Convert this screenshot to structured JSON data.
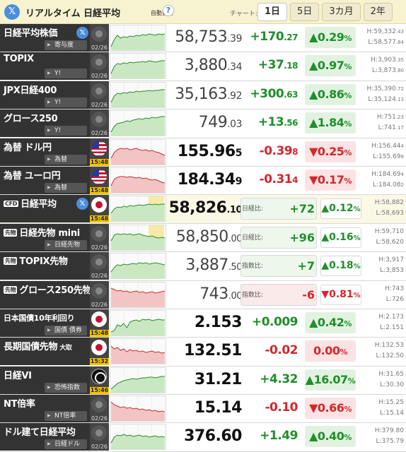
{
  "header": {
    "x_icon": "x-logo-icon",
    "title": "リアルタイム 日経平均",
    "auto_update": "自動更新",
    "help": "?",
    "chart_label": "チャート:",
    "tabs": [
      {
        "label": "1日",
        "active": true
      },
      {
        "label": "5日",
        "active": false
      },
      {
        "label": "3カ月",
        "active": false
      },
      {
        "label": "2年",
        "active": false
      }
    ]
  },
  "colors": {
    "up": "#1f8f2a",
    "down": "#d6262b",
    "up_bg": "#e2f2e0",
    "down_bg": "#fbe3e3",
    "label_bg": "#333333",
    "accent_yellow": "#f2c200"
  },
  "rows": [
    {
      "name": "日経平均株価",
      "sub": "寄与度",
      "x": true,
      "flag": "jp",
      "time": "02/26",
      "live": false,
      "price_int": "58,753",
      "price_dec": ".39",
      "chg_int": "+170",
      "chg_dec": ".27",
      "dir": "up",
      "pct": "0.29",
      "high": "59,332",
      "high_dec": ".43",
      "low": "58,577",
      "low_dec": ".84",
      "spark": [
        30,
        20,
        14,
        18,
        16,
        17,
        15,
        16,
        14,
        15,
        13,
        14,
        12,
        13,
        14,
        12,
        13,
        12
      ]
    },
    {
      "name": "TOPIX",
      "sub": "Y!",
      "flag": "jp",
      "time": "02/26",
      "live": false,
      "price_int": "3,880",
      "price_dec": ".34",
      "chg_int": "+37",
      "chg_dec": ".18",
      "dir": "up",
      "pct": "0.97",
      "high": "3,903",
      "high_dec": ".35",
      "low": "3,873",
      "low_dec": ".80",
      "spark": [
        28,
        18,
        14,
        15,
        13,
        14,
        12,
        13,
        12,
        12,
        11,
        12,
        10,
        11,
        12,
        11,
        10,
        10
      ]
    },
    {
      "name": "JPX日経400",
      "sub": "Y!",
      "flag": "jp",
      "time": "02/26",
      "live": false,
      "price_int": "35,163",
      "price_dec": ".92",
      "chg_int": "+300",
      "chg_dec": ".63",
      "dir": "up",
      "pct": "0.86",
      "high": "35,390",
      "high_dec": ".72",
      "low": "35,124",
      "low_dec": ".13",
      "spark": [
        28,
        19,
        15,
        16,
        14,
        15,
        13,
        14,
        12,
        13,
        12,
        12,
        11,
        12,
        11,
        11,
        10,
        10
      ]
    },
    {
      "name": "グロース250",
      "sub": "Y!",
      "flag": "jp",
      "time": "02/26",
      "live": false,
      "price_int": "749",
      "price_dec": ".03",
      "chg_int": "+13",
      "chg_dec": ".56",
      "dir": "up",
      "pct": "1.84",
      "high": "751",
      "high_dec": ".23",
      "low": "741",
      "low_dec": ".17",
      "spark": [
        30,
        22,
        18,
        17,
        16,
        14,
        15,
        13,
        12,
        11,
        12,
        10,
        11,
        9,
        10,
        9,
        8,
        8
      ]
    },
    {
      "name": "為替 ドル円",
      "sub": "為替",
      "flag": "us",
      "time": "15:48",
      "live": true,
      "price_int": "155.96",
      "price_dec": "5",
      "chg_int": "-0.39",
      "chg_dec": "8",
      "dir": "down",
      "pct": "0.25",
      "high": "156.44",
      "high_dec": "4",
      "low": "155.69",
      "low_dec": "8",
      "strong": true,
      "spark": [
        26,
        18,
        14,
        12,
        13,
        12,
        14,
        13,
        12,
        14,
        15,
        14,
        16,
        15,
        17,
        18,
        20,
        22
      ]
    },
    {
      "name": "為替 ユーロ円",
      "sub": "為替",
      "flag": "us",
      "time": "15:48",
      "live": true,
      "price_int": "184.34",
      "price_dec": "9",
      "chg_int": "-0.31",
      "chg_dec": "4",
      "dir": "down",
      "pct": "0.17",
      "high": "184.69",
      "high_dec": "4",
      "low": "184.08",
      "low_dec": "2",
      "strong": true,
      "spark": [
        25,
        16,
        13,
        12,
        12,
        13,
        12,
        13,
        14,
        13,
        15,
        14,
        16,
        17,
        16,
        18,
        20,
        21
      ]
    }
  ],
  "futures": [
    {
      "name": "日経平均",
      "prefix": "CFD",
      "x": true,
      "flag": "jp",
      "time": "15:48",
      "live": true,
      "cfd": true,
      "price_int": "58,826",
      "price_dec": ".10",
      "tag": "日経比:",
      "chg": "+72",
      "dir": "up",
      "pct": "0.12",
      "high": "58,882",
      "low": "58,693",
      "spark": [
        24,
        18,
        15,
        16,
        14,
        15,
        13,
        14,
        13,
        12,
        13,
        12,
        11,
        12,
        11,
        12,
        11,
        11
      ]
    },
    {
      "name": "日経先物 mini",
      "prefix": "先物",
      "sub": "日経先物",
      "flag": "jp",
      "time": "02/26",
      "live": false,
      "price_int": "58,850",
      "price_dec": ".00",
      "tag": "日経比:",
      "chg": "+96",
      "dir": "up",
      "pct": "0.16",
      "high": "59,710",
      "low": "58,620",
      "spark": [
        22,
        14,
        12,
        13,
        12,
        13,
        12,
        14,
        13,
        12,
        14,
        15,
        16,
        15,
        17,
        18,
        17,
        18
      ]
    },
    {
      "name": "TOPIX先物",
      "prefix": "先物",
      "flag": "jp",
      "time": "02/26",
      "live": false,
      "price_int": "3,887",
      "price_dec": ".50",
      "tag": "指数比:",
      "chg": "+7",
      "dir": "up",
      "pct": "0.18",
      "high": "3,917",
      "low": "3,853",
      "spark": [
        26,
        20,
        16,
        17,
        15,
        16,
        15,
        14,
        15,
        13,
        14,
        13,
        15,
        14,
        13,
        14,
        15,
        16
      ]
    },
    {
      "name": "グロース250先物",
      "prefix": "先物",
      "flag": "jp",
      "time": "02/26",
      "live": false,
      "price_int": "743",
      "price_dec": ".00",
      "tag": "指数比:",
      "chg": "-6",
      "dir": "down",
      "pct": "0.81",
      "high": "743",
      "low": "726",
      "spark": [
        8,
        10,
        12,
        11,
        13,
        12,
        14,
        13,
        12,
        14,
        13,
        15,
        14,
        13,
        15,
        14,
        13,
        12
      ]
    }
  ],
  "rates": [
    {
      "name": "日本国債10年利回り",
      "sub": "国債 債券",
      "flag": "jp",
      "time": "15:48",
      "live": true,
      "small": true,
      "price": "2.153",
      "chg": "+0.009",
      "dir": "up",
      "pct": "0.42",
      "high": "2.173",
      "low": "2.151",
      "spark": [
        30,
        28,
        20,
        22,
        18,
        24,
        16,
        14,
        13,
        15,
        12,
        13,
        12,
        14,
        13,
        12,
        13,
        13
      ]
    },
    {
      "name": "長期国債先物",
      "suffix": "大取",
      "flag": "jp",
      "time": "15:32",
      "live": true,
      "price": "132.51",
      "chg": "-0.02",
      "dir": "down",
      "pct": "0.00",
      "flatpct": true,
      "high": "132.53",
      "low": "132.50",
      "spark": [
        10,
        14,
        12,
        16,
        14,
        18,
        15,
        17,
        16,
        18,
        17,
        19,
        18,
        17,
        19,
        18,
        20,
        19
      ]
    },
    {
      "name": "日経VI",
      "sub": "恐怖指数",
      "flag": "vi",
      "time": "15:46",
      "live": true,
      "price": "31.21",
      "chg": "+4.32",
      "dir": "up",
      "pct": "16.07",
      "high": "31.65",
      "low": "30.30",
      "spark": [
        30,
        26,
        22,
        20,
        18,
        17,
        16,
        15,
        16,
        15,
        14,
        14,
        13,
        13,
        14,
        13,
        12,
        12
      ]
    },
    {
      "name": "NT倍率",
      "sub": "NT倍率",
      "flag": "jp",
      "time": "02/26",
      "live": false,
      "price": "15.14",
      "chg": "-0.10",
      "dir": "down",
      "pct": "0.66",
      "high": "15.25",
      "low": "15.14",
      "spark": [
        8,
        12,
        14,
        16,
        15,
        17,
        16,
        18,
        17,
        19,
        18,
        20,
        19,
        21,
        20,
        22,
        21,
        22
      ]
    },
    {
      "name": "ドル建て日経平均",
      "sub": "日経ドル",
      "flag": "jp",
      "time": "02/26",
      "live": false,
      "price": "376.60",
      "chg": "+1.49",
      "dir": "up",
      "pct": "0.40",
      "high": "379.80",
      "low": "375.79",
      "spark": [
        26,
        18,
        15,
        16,
        14,
        16,
        15,
        17,
        16,
        15,
        17,
        16,
        18,
        17,
        16,
        18,
        17,
        18
      ]
    }
  ]
}
